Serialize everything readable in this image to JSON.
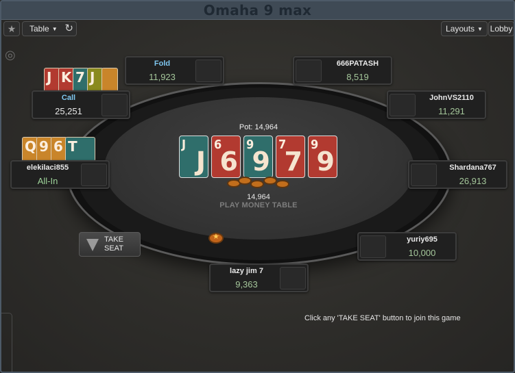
{
  "window": {
    "title": "Omaha 9 max"
  },
  "toolbar": {
    "table_label": "Table",
    "layouts_label": "Layouts",
    "lobby_label": "Lobby"
  },
  "icons": {
    "star": "star-icon",
    "refresh": "refresh-icon",
    "caret": "caret-down-icon",
    "target": "target-icon"
  },
  "pot": {
    "label": "Pot: 14,964",
    "amount": "14,964"
  },
  "board_cards": [
    {
      "rank": "J",
      "color": "#2f6e6b"
    },
    {
      "rank": "6",
      "color": "#b23a30"
    },
    {
      "rank": "9",
      "color": "#2f6e6b"
    },
    {
      "rank": "7",
      "color": "#b23a30"
    },
    {
      "rank": "9",
      "color": "#b23a30"
    }
  ],
  "table_label": "PLAY MONEY TABLE",
  "seats": [
    {
      "name": "Fold",
      "stack": "11,923"
    },
    {
      "name": "666PATASH",
      "stack": "8,519"
    },
    {
      "name": "Call",
      "stack": "25,251"
    },
    {
      "name": "JohnVS2110",
      "stack": "11,291"
    },
    {
      "name": "elekilaci855",
      "stack": "All-In"
    },
    {
      "name": "Shardana767",
      "stack": "26,913"
    },
    {
      "name": "yuriy695",
      "stack": "10,000"
    },
    {
      "name": "lazy jim 7",
      "stack": "9,363"
    }
  ],
  "hands": {
    "call_hand": [
      {
        "rank": "J",
        "color": "#b23a30"
      },
      {
        "rank": "K",
        "color": "#b23a30"
      },
      {
        "rank": "7",
        "color": "#2f6e6b"
      },
      {
        "rank": "J",
        "color": "#8a8a1e"
      }
    ],
    "allin_hand": [
      {
        "rank": "Q",
        "color": "#c9852a"
      },
      {
        "rank": "9",
        "color": "#c9852a"
      },
      {
        "rank": "6",
        "color": "#c9852a"
      },
      {
        "rank": "T",
        "color": "#2f6e6b"
      }
    ]
  },
  "take_seat": {
    "line1": "TAKE",
    "line2": "SEAT"
  },
  "join_text": "Click any 'TAKE SEAT' button to join this game",
  "colors": {
    "felt": "#363636",
    "stack_green": "#a5c79b",
    "action_blue": "#7fc7f0",
    "title_bar": "#3f4a55"
  }
}
